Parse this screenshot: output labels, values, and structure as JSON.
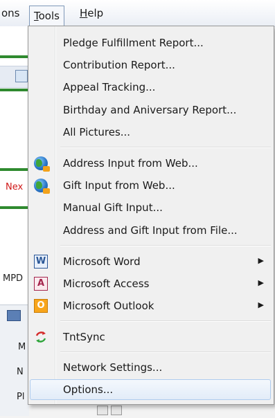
{
  "menubar": {
    "partial_label": "ons",
    "tools_label": "Tools",
    "tools_underline": "T",
    "tools_rest": "ools",
    "help_underline": "H",
    "help_rest": "elp"
  },
  "background": {
    "next_fragment": "Nex",
    "mpd_fragment": "MPD",
    "m_fragment": "M",
    "n_fragment": "N",
    "p_fragment": "Pl"
  },
  "tools_menu": {
    "items": [
      {
        "label": "Pledge Fulfillment Report..."
      },
      {
        "label": "Contribution Report..."
      },
      {
        "label": "Appeal Tracking..."
      },
      {
        "label": "Birthday and Aniversary Report..."
      },
      {
        "label": "All Pictures..."
      },
      {
        "label": "Address Input from Web...",
        "icon": "globe-icon"
      },
      {
        "label": "Gift Input from Web...",
        "icon": "globe-icon"
      },
      {
        "label": "Manual Gift Input..."
      },
      {
        "label": "Address and Gift Input from File..."
      },
      {
        "label": "Microsoft Word",
        "icon": "word-icon",
        "icon_letter": "W",
        "submenu": true
      },
      {
        "label": "Microsoft Access",
        "icon": "access-icon",
        "icon_letter": "A",
        "submenu": true
      },
      {
        "label": "Microsoft Outlook",
        "icon": "outlook-icon",
        "icon_letter": "O",
        "submenu": true
      },
      {
        "label": "TntSync",
        "icon": "sync-icon"
      },
      {
        "label": "Network Settings..."
      },
      {
        "label": "Options...",
        "highlighted": true
      }
    ],
    "submenu_arrow": "▶"
  },
  "colors": {
    "menu_bg": "#f0f0f0",
    "highlight_border": "#aecbee",
    "next_text": "#d01818",
    "stripe_green": "#2f8a2f"
  }
}
